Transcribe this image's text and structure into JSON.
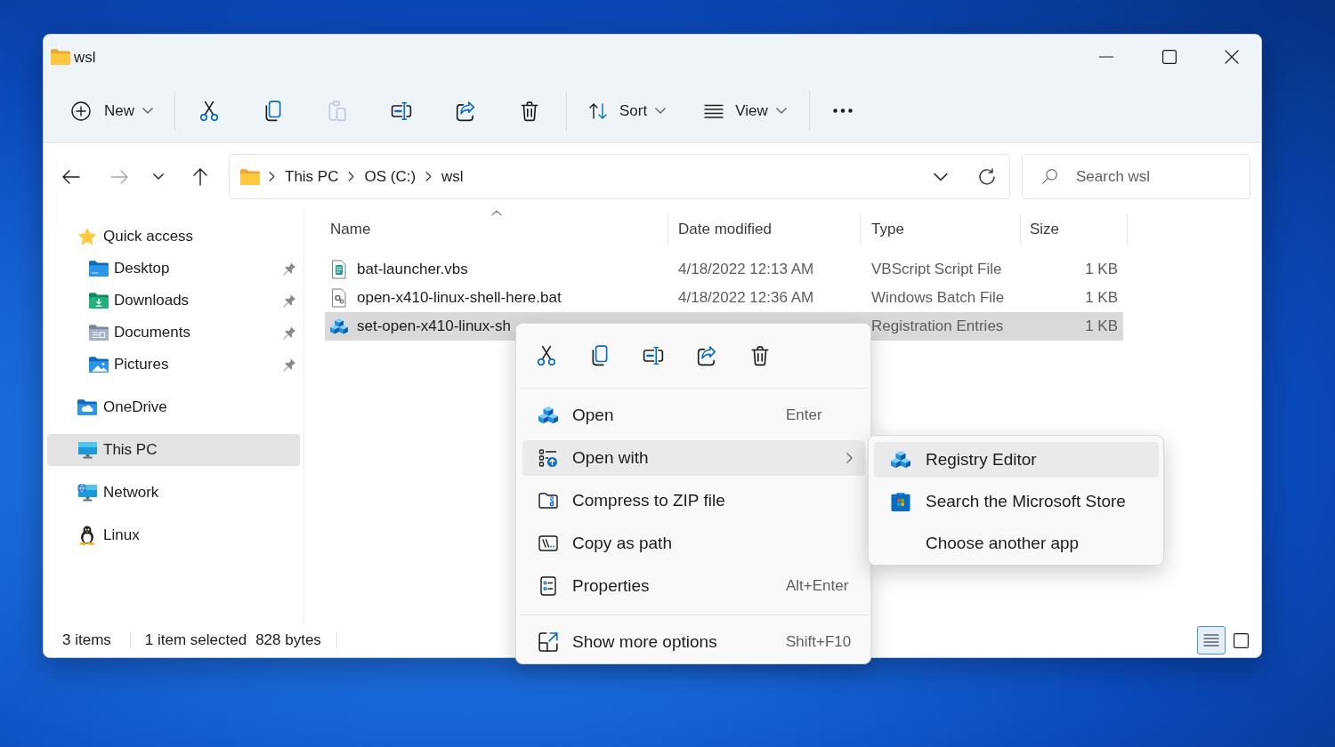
{
  "window": {
    "title": "wsl"
  },
  "toolbar": {
    "new_button": {
      "label": "New"
    },
    "actions": [
      {
        "disabled": false
      },
      {
        "disabled": false
      },
      {
        "disabled": true
      },
      {
        "disabled": false
      },
      {
        "disabled": false
      },
      {
        "disabled": false
      }
    ],
    "sort_button": {
      "label": "Sort"
    },
    "view_button": {
      "label": "View"
    }
  },
  "navigation": {
    "buttons": [
      {
        "disabled": false
      },
      {
        "disabled": true
      },
      {
        "disabled": false
      },
      {
        "disabled": false
      }
    ]
  },
  "address_bar": {
    "breadcrumbs": [
      "This PC",
      "OS (C:)",
      "wsl"
    ]
  },
  "search": {
    "placeholder": "Search wsl"
  },
  "sidebar": {
    "items": [
      {
        "label": "Quick access",
        "selected": false,
        "children": [
          {
            "label": "Desktop",
            "pinned": true,
            "selected": false
          },
          {
            "label": "Downloads",
            "pinned": true,
            "selected": false
          },
          {
            "label": "Documents",
            "pinned": true,
            "selected": false
          },
          {
            "label": "Pictures",
            "pinned": true,
            "selected": false
          }
        ]
      },
      {
        "label": "OneDrive",
        "selected": false
      },
      {
        "label": "This PC",
        "selected": true
      },
      {
        "label": "Network",
        "selected": false
      },
      {
        "label": "Linux",
        "selected": false
      }
    ]
  },
  "file_list": {
    "columns": [
      {
        "label": "Name",
        "sorted": true
      },
      {
        "label": "Date modified",
        "sorted": false
      },
      {
        "label": "Type",
        "sorted": false
      },
      {
        "label": "Size",
        "sorted": false
      }
    ],
    "rows": [
      {
        "kind": "script",
        "name": "bat-launcher.vbs",
        "date_modified": "4/18/2022 12:13 AM",
        "type": "VBScript Script File",
        "size": "1 KB",
        "selected": false
      },
      {
        "kind": "batch",
        "name": "open-x410-linux-shell-here.bat",
        "date_modified": "4/18/2022 12:36 AM",
        "type": "Windows Batch File",
        "size": "1 KB",
        "selected": false
      },
      {
        "kind": "registry",
        "name": "set-open-x410-linux-sh",
        "type": "Registration Entries",
        "size": "1 KB",
        "selected": true
      }
    ]
  },
  "context_menu": {
    "items": [
      {
        "kind": "command",
        "label": "Open",
        "shortcut": "Enter",
        "selected": false
      },
      {
        "kind": "submenu",
        "label": "Open with",
        "selected": true
      },
      {
        "kind": "command",
        "label": "Compress to ZIP file",
        "selected": false
      },
      {
        "kind": "command",
        "label": "Copy as path",
        "selected": false
      },
      {
        "kind": "command",
        "label": "Properties",
        "shortcut": "Alt+Enter",
        "selected": false
      },
      {
        "kind": "separator"
      },
      {
        "kind": "command",
        "label": "Show more options",
        "shortcut": "Shift+F10",
        "selected": false
      }
    ]
  },
  "submenu": {
    "items": [
      {
        "label": "Registry Editor",
        "selected": true
      },
      {
        "label": "Search the Microsoft Store",
        "selected": false
      },
      {
        "label": "Choose another app",
        "selected": false
      }
    ]
  },
  "status_bar": {
    "item_count": "3 items",
    "selection": "1 item selected",
    "selection_size": "828 bytes",
    "views": [
      {
        "selected": true
      },
      {
        "selected": false
      }
    ]
  }
}
